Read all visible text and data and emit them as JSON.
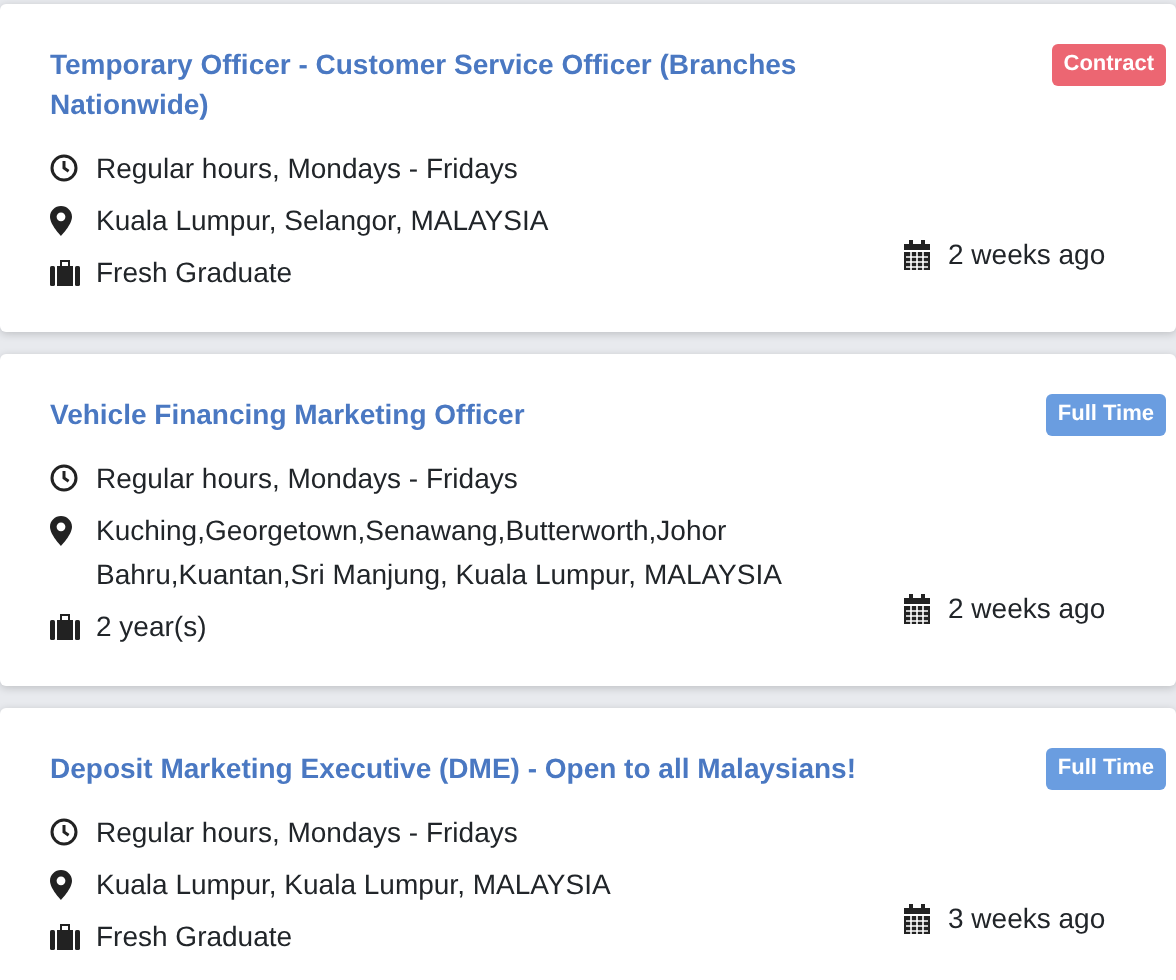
{
  "jobs": [
    {
      "title": "Temporary Officer - Customer Service Officer (Branches Nationwide)",
      "badge": {
        "label": "Contract",
        "color": "#ec6672"
      },
      "hours": "Regular hours, Mondays - Fridays",
      "location": "Kuala Lumpur, Selangor, MALAYSIA",
      "experience": "Fresh Graduate",
      "posted": "2 weeks ago"
    },
    {
      "title": "Vehicle Financing Marketing Officer",
      "badge": {
        "label": "Full Time",
        "color": "#6a9de0"
      },
      "hours": "Regular hours, Mondays - Fridays",
      "location": "Kuching,Georgetown,Senawang,Butterworth,Johor Bahru,Kuantan,Sri Manjung, Kuala Lumpur, MALAYSIA",
      "experience": "2 year(s)",
      "posted": "2 weeks ago"
    },
    {
      "title": "Deposit Marketing Executive (DME) - Open to all Malaysians!",
      "badge": {
        "label": "Full Time",
        "color": "#6a9de0"
      },
      "hours": "Regular hours, Mondays - Fridays",
      "location": "Kuala Lumpur, Kuala Lumpur, MALAYSIA",
      "experience": "Fresh Graduate",
      "posted": "3 weeks ago"
    }
  ]
}
